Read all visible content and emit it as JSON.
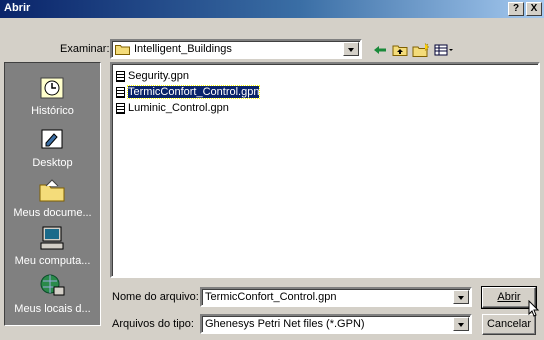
{
  "titlebar": {
    "title": "Abrir",
    "help_label": "?",
    "close_label": "X"
  },
  "lookin": {
    "label": "Examinar:",
    "value": "Intelligent_Buildings"
  },
  "toolbar": {
    "icons": [
      "back-arrow-icon",
      "up-folder-icon",
      "new-folder-icon",
      "view-menu-icon"
    ]
  },
  "places": [
    {
      "label": "Histórico",
      "icon": "history-icon"
    },
    {
      "label": "Desktop",
      "icon": "desktop-icon"
    },
    {
      "label": "Meus docume...",
      "icon": "my-documents-icon"
    },
    {
      "label": "Meu computa...",
      "icon": "my-computer-icon"
    },
    {
      "label": "Meus locais d...",
      "icon": "network-places-icon"
    }
  ],
  "files": [
    {
      "name": "Segurity.gpn",
      "selected": false
    },
    {
      "name": "TermicConfort_Control.gpn",
      "selected": true
    },
    {
      "name": "Luminic_Control.gpn",
      "selected": false
    }
  ],
  "filename": {
    "label": "Nome do arquivo:",
    "value": "TermicConfort_Control.gpn"
  },
  "filetype": {
    "label": "Arquivos do tipo:",
    "value": "Ghenesys Petri Net files (*.GPN)"
  },
  "buttons": {
    "open": "Abrir",
    "cancel": "Cancelar"
  },
  "colors": {
    "title_start": "#0a246a",
    "title_end": "#a6caf0",
    "face": "#d4d0c8",
    "places_bg": "#808080"
  }
}
